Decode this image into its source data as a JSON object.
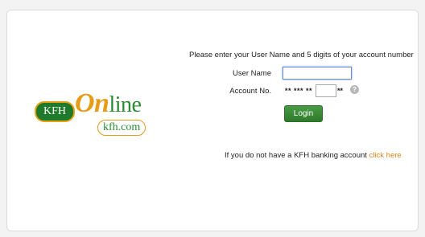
{
  "logo": {
    "kfh": "KFH",
    "on": "On",
    "line": "line",
    "domain": "kfh.com"
  },
  "form": {
    "instruction": "Please enter your User Name and 5 digits of your account number",
    "username_label": "User Name",
    "username_value": "",
    "account_label": "Account No.",
    "account_masked_prefix": "** *** **",
    "account_value": "",
    "account_masked_suffix": "**",
    "help_icon": "question-mark-icon",
    "help_glyph": "?",
    "login_label": "Login"
  },
  "footer": {
    "text": "If you do not have a KFH banking account",
    "link_text": "click here"
  },
  "colors": {
    "brand_green": "#2b8b35",
    "brand_orange": "#e79c17",
    "link_orange": "#e0851d",
    "button_green": "#3a8a36"
  }
}
